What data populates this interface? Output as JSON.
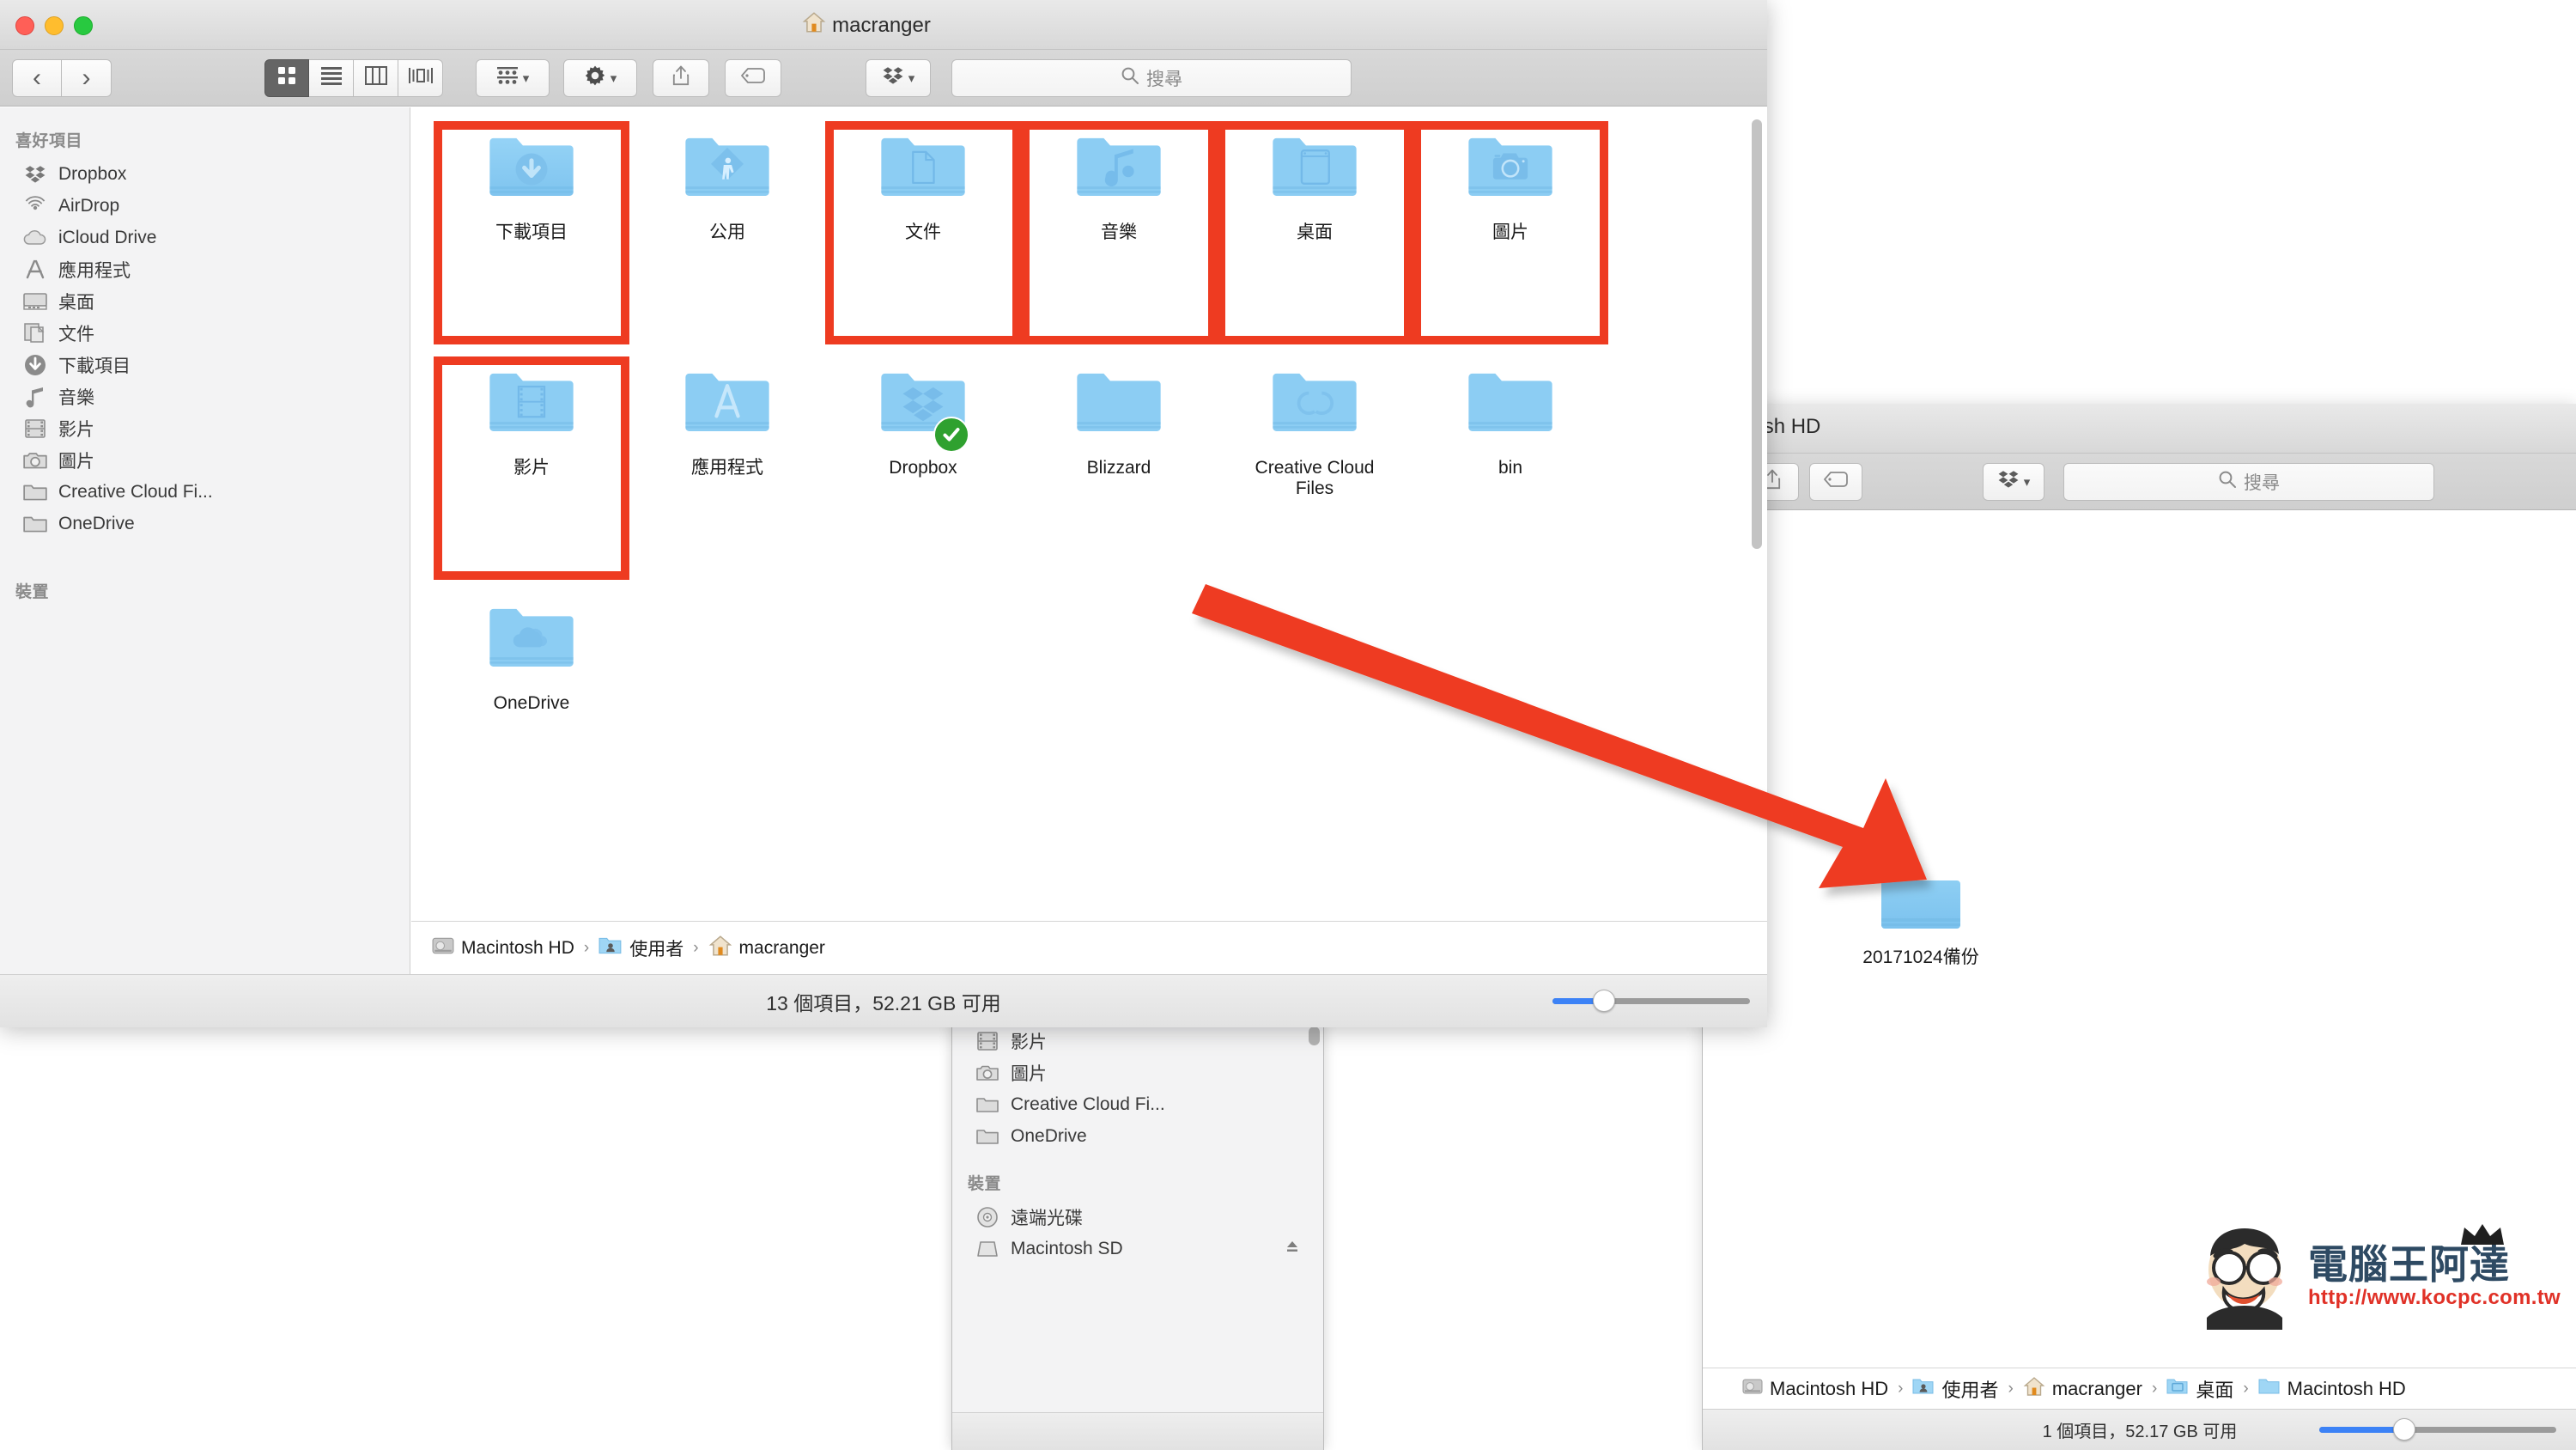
{
  "window_main": {
    "title": "macranger",
    "title_icon": "home-icon",
    "traffic_lights": [
      "close",
      "minimize",
      "zoom"
    ],
    "nav": {
      "back": "‹",
      "forward": "›"
    },
    "view_modes": [
      "icon-view",
      "list-view",
      "column-view",
      "coverflow-view"
    ],
    "toolbar": {
      "arrange_label": "arrange-icon",
      "action_label": "gear-icon",
      "share_label": "share-icon",
      "tag_label": "tag-icon",
      "dropbox_label": "dropbox-icon",
      "search_placeholder": "搜尋"
    },
    "sidebar": {
      "sections": [
        {
          "title": "喜好項目",
          "items": [
            {
              "label": "Dropbox",
              "icon": "dropbox-icon"
            },
            {
              "label": "AirDrop",
              "icon": "airdrop-icon"
            },
            {
              "label": "iCloud Drive",
              "icon": "icloud-icon"
            },
            {
              "label": "應用程式",
              "icon": "applications-icon"
            },
            {
              "label": "桌面",
              "icon": "desktop-icon"
            },
            {
              "label": "文件",
              "icon": "documents-icon"
            },
            {
              "label": "下載項目",
              "icon": "downloads-icon"
            },
            {
              "label": "音樂",
              "icon": "music-icon"
            },
            {
              "label": "影片",
              "icon": "movies-icon"
            },
            {
              "label": "圖片",
              "icon": "pictures-icon"
            },
            {
              "label": "Creative Cloud Fi...",
              "icon": "folder-icon"
            },
            {
              "label": "OneDrive",
              "icon": "folder-icon"
            }
          ]
        },
        {
          "title": "裝置",
          "items": []
        }
      ]
    },
    "items": [
      {
        "label": "下載項目",
        "icon": "folder-downloads",
        "highlighted": true
      },
      {
        "label": "公用",
        "icon": "folder-public",
        "highlighted": false
      },
      {
        "label": "文件",
        "icon": "folder-documents",
        "highlighted": true
      },
      {
        "label": "音樂",
        "icon": "folder-music",
        "highlighted": true
      },
      {
        "label": "桌面",
        "icon": "folder-desktop",
        "highlighted": true
      },
      {
        "label": "圖片",
        "icon": "folder-pictures",
        "highlighted": true
      },
      {
        "label": "影片",
        "icon": "folder-movies",
        "highlighted": true
      },
      {
        "label": "應用程式",
        "icon": "folder-applications",
        "highlighted": false
      },
      {
        "label": "Dropbox",
        "icon": "folder-dropbox",
        "highlighted": false,
        "badge": "sync-ok-badge"
      },
      {
        "label": "Blizzard",
        "icon": "folder-plain",
        "highlighted": false
      },
      {
        "label": "Creative Cloud Files",
        "icon": "folder-creative-cloud",
        "highlighted": false
      },
      {
        "label": "bin",
        "icon": "folder-plain",
        "highlighted": false
      },
      {
        "label": "OneDrive",
        "icon": "folder-onedrive",
        "highlighted": false
      }
    ],
    "breadcrumb": [
      {
        "label": "Macintosh HD",
        "icon": "harddisk-icon"
      },
      {
        "label": "使用者",
        "icon": "users-folder-icon"
      },
      {
        "label": "macranger",
        "icon": "home-icon"
      }
    ],
    "status": "13 個項目，52.21 GB 可用",
    "zoom_fill_percent": 26
  },
  "window_right": {
    "title": "cintosh HD",
    "toolbar": {
      "share_label": "share-icon",
      "tag_label": "tag-icon",
      "dropbox_label": "dropbox-icon",
      "search_placeholder": "搜尋"
    },
    "items": [
      {
        "label": "20171024備份",
        "icon": "folder-plain"
      }
    ],
    "breadcrumb": [
      {
        "label": "Macintosh HD",
        "icon": "harddisk-icon"
      },
      {
        "label": "使用者",
        "icon": "users-folder-icon"
      },
      {
        "label": "macranger",
        "icon": "home-icon"
      },
      {
        "label": "桌面",
        "icon": "desktop-folder-icon"
      },
      {
        "label": "Macintosh HD",
        "icon": "folder-icon-blue"
      }
    ],
    "status": "1 個項目，52.17 GB 可用",
    "zoom_fill_percent": 36
  },
  "window_back": {
    "sidebar": {
      "sections": [
        {
          "title": "",
          "items": [
            {
              "label": "影片",
              "icon": "movies-icon"
            },
            {
              "label": "圖片",
              "icon": "pictures-icon"
            },
            {
              "label": "Creative Cloud Fi...",
              "icon": "folder-icon"
            },
            {
              "label": "OneDrive",
              "icon": "folder-icon"
            }
          ]
        },
        {
          "title": "裝置",
          "items": [
            {
              "label": "遠端光碟",
              "icon": "disc-icon"
            },
            {
              "label": "Macintosh SD",
              "icon": "drive-icon",
              "eject": true
            }
          ]
        }
      ]
    }
  },
  "annotation": {
    "arrow_color": "#ee3b21",
    "highlight_color": "#ee3b21",
    "badge_color": "#29a329"
  },
  "watermark": {
    "title": "電腦王阿達",
    "url": "http://www.kocpc.com.tw"
  }
}
